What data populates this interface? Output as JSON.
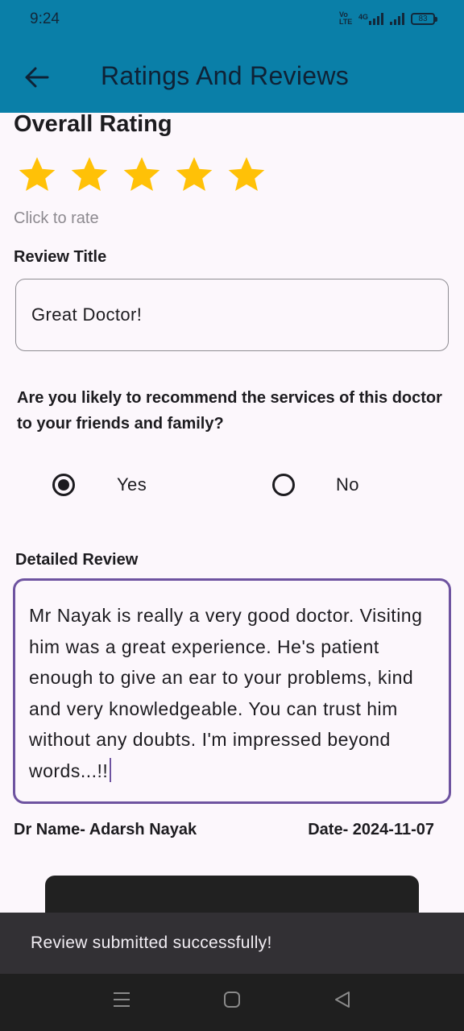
{
  "status_bar": {
    "time": "9:24",
    "volte": "Vo LTE",
    "network": "4G",
    "battery": "83"
  },
  "app_bar": {
    "title": "Ratings And Reviews",
    "back_icon": "arrow-left-icon"
  },
  "rating": {
    "heading": "Overall Rating",
    "stars_filled": 5,
    "stars_total": 5,
    "star_color": "#FFC107",
    "hint": "Click to rate"
  },
  "review_title": {
    "label": "Review Title",
    "value": "Great Doctor!"
  },
  "recommend": {
    "question": "Are you likely to recommend the services of this doctor to your friends and family?",
    "options": [
      {
        "label": "Yes",
        "selected": true
      },
      {
        "label": "No",
        "selected": false
      }
    ]
  },
  "detailed_review": {
    "label": "Detailed Review",
    "value": "Mr Nayak is really a very good doctor. Visiting him was a great experience. He's patient enough to give an ear to your problems, kind and very knowledgeable. You can trust him without any doubts. I'm impressed beyond words...!!",
    "focus_color": "#6E53A0"
  },
  "footer_info": {
    "doctor": "Dr Name- Adarsh Nayak",
    "date": "Date- 2024-11-07"
  },
  "snackbar": {
    "message": "Review submitted successfully!"
  },
  "colors": {
    "app_bar": "#0A7FA8",
    "background": "#FCF7FC",
    "snackbar": "#323034",
    "nav_bar": "#1F1F1F"
  }
}
